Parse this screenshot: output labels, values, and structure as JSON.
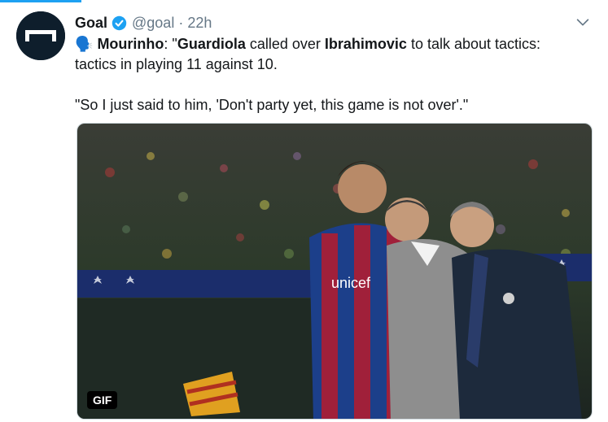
{
  "tweet": {
    "author_name": "Goal",
    "handle": "@goal",
    "separator": "·",
    "time": "22h",
    "emoji": "🗣️",
    "text_line1": {
      "speaker": "Mourinho",
      "part1": ": \"",
      "name1": "Guardiola",
      "part2": " called over ",
      "name2": "Ibrahimovic",
      "part3": " to talk about tactics:"
    },
    "text_line2": "tactics in playing 11 against 10.",
    "text_quote": "\"So I just said to him, 'Don't party yet, this game is not over'.\"",
    "media_badge": "GIF",
    "jersey_text": "unicef"
  },
  "colors": {
    "accent": "#1da1f2",
    "verified": "#1da1f2",
    "muted": "#657786",
    "avatar_bg": "#0e1e2c"
  },
  "icons": {
    "verified": "verified-badge-icon",
    "chevron": "chevron-down-icon",
    "emoji": "speaking-head-emoji"
  }
}
